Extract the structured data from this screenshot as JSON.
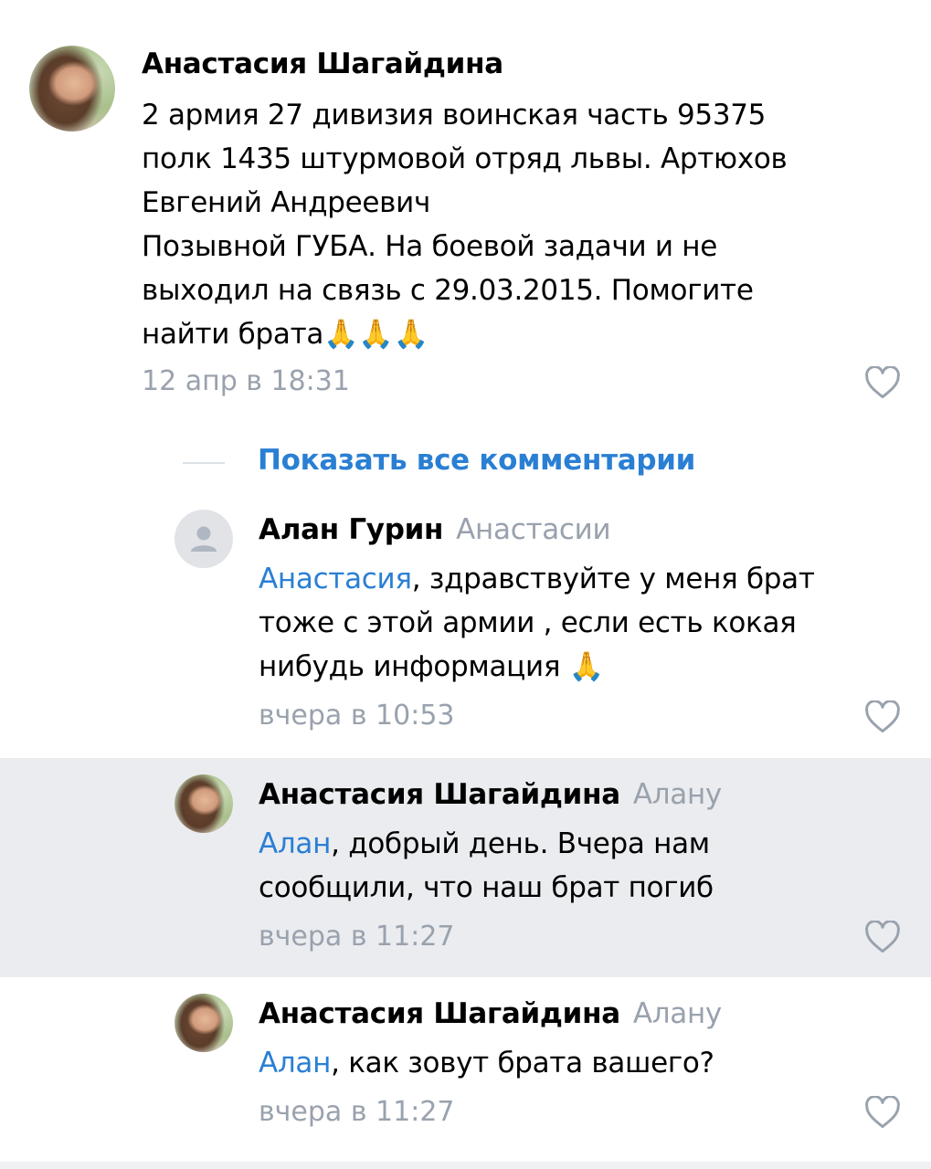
{
  "comments": [
    {
      "author": "Анастасия Шагайдина",
      "reply_to": "",
      "text": "2 армия 27 дивизия воинская часть 95375\nполк 1435 штурмовой отряд львы. Артюхов\nЕвгений Андреевич\nПозывной ГУБА. На боевой задачи и не\nвыходил на связь с 29.03.2015. Помогите\nнайти брата",
      "emoji": "🙏🙏🙏",
      "time": "12 апр в 18:31",
      "avatar": "user-photo"
    },
    {
      "author": "Алан Гурин",
      "reply_to": "Анастасии",
      "mention": "Анастасия",
      "text": ", здравствуйте у меня брат\nтоже с этой армии , если есть кокая\nнибудь информация ",
      "emoji": "🙏",
      "time": "вчера в 10:53",
      "avatar": "user-placeholder-icon"
    },
    {
      "author": "Анастасия Шагайдина",
      "reply_to": "Алану",
      "mention": "Алан",
      "text": ", добрый день. Вчера нам\nсообщили, что наш брат погиб",
      "time": "вчера в 11:27",
      "avatar": "user-photo"
    },
    {
      "author": "Анастасия Шагайдина",
      "reply_to": "Алану",
      "mention": "Алан",
      "text": ", как зовут брата вашего?",
      "time": "вчера в 11:27",
      "avatar": "user-photo"
    }
  ],
  "show_all_comments": "Показать все комментарии",
  "icons": {
    "like": "heart-icon"
  },
  "colors": {
    "link": "#2a7fd4",
    "meta": "#99a2ad",
    "highlight": "#ebecef"
  }
}
